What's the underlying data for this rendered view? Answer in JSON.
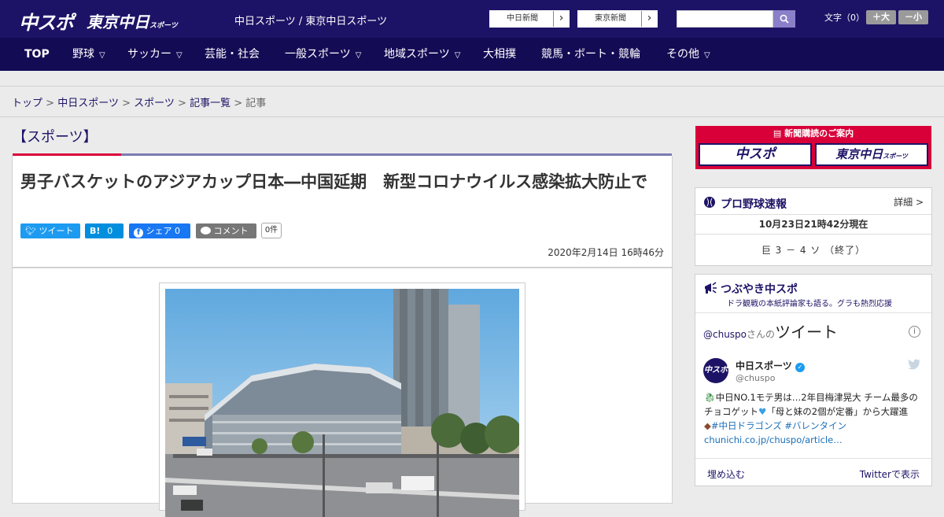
{
  "header": {
    "logo_chuspo": "中スポ",
    "logo_tokyo": "東京中日",
    "logo_tokyo_small": "スポーツ",
    "site_links": "中日スポーツ / 東京中日スポーツ",
    "btn_chunichi": "中日新聞",
    "btn_tokyo": "東京新聞",
    "fontsize_label": "文字（0）",
    "font_larger": "＋大",
    "font_smaller": "－小"
  },
  "nav": [
    {
      "label": "TOP",
      "dropdown": false
    },
    {
      "label": "野球",
      "dropdown": true
    },
    {
      "label": "サッカー",
      "dropdown": true
    },
    {
      "label": "芸能・社会",
      "dropdown": false
    },
    {
      "label": "一般スポーツ",
      "dropdown": true
    },
    {
      "label": "地域スポーツ",
      "dropdown": true
    },
    {
      "label": "大相撲",
      "dropdown": false
    },
    {
      "label": "競馬・ボート・競輪",
      "dropdown": false
    },
    {
      "label": "その他",
      "dropdown": true
    }
  ],
  "breadcrumb": {
    "items": [
      "トップ",
      "中日スポーツ",
      "スポーツ",
      "記事一覧"
    ],
    "current": "記事",
    "sep": ">"
  },
  "article": {
    "section": "【スポーツ】",
    "headline": "男子バスケットのアジアカップ日本―中国延期　新型コロナウイルス感染拡大防止で",
    "share_tweet": "ツイート",
    "share_hatena": "B!",
    "share_hatena_count": "0",
    "share_facebook": "シェア",
    "share_facebook_count": "0",
    "share_comment": "コメント",
    "comment_count": "0件",
    "date": "2020年2月14日 16時46分"
  },
  "sidebar": {
    "subscribe_title": "新聞購読のご案内",
    "subscribe_chuspo": "中スポ",
    "subscribe_tokyo": "東京中日",
    "subscribe_tokyo_small": "スポーツ",
    "baseball_title": "プロ野球速報",
    "baseball_detail": "詳細 >",
    "baseball_time": "10月23日21時42分現在",
    "baseball_score": "巨 3 － 4 ソ （終了）",
    "twitter_title": "つぶやき中スポ",
    "twitter_sub": "ドラ観戦の本紙評論家も語る。グラも熱烈応援",
    "tw_user_prefix": "@chuspo",
    "tw_user_suffix": "さんの",
    "tw_head_big": "ツイート",
    "tw_avatar": "中スポ",
    "tw_name": "中日スポーツ",
    "tw_handle": "@chuspo",
    "tw_text_1": "中日NO.1モテ男は…2年目梅津晃大 チーム最多のチョコゲット",
    "tw_text_2": "「母と妹の2個が定番」から大躍進",
    "tw_tag_1": "#中日ドラゴンズ",
    "tw_tag_2": "#バレンタイン",
    "tw_link": "chunichi.co.jp/chuspo/article…",
    "tw_embed": "埋め込む",
    "tw_view": "Twitterで表示"
  },
  "colors": {
    "brand_navy": "#1d1366",
    "accent_red": "#d9003a",
    "twitter_blue": "#1d9bf0",
    "hatena_blue": "#008fde",
    "facebook_blue": "#1877f2",
    "comment_gray": "#777777"
  },
  "icons": [
    "search-icon",
    "chevron-right-icon",
    "chevron-down-icon",
    "twitter-bird-icon",
    "facebook-icon",
    "comment-bubble-icon",
    "baseball-icon",
    "megaphone-icon",
    "info-icon",
    "verified-badge-icon",
    "newspaper-icon"
  ]
}
